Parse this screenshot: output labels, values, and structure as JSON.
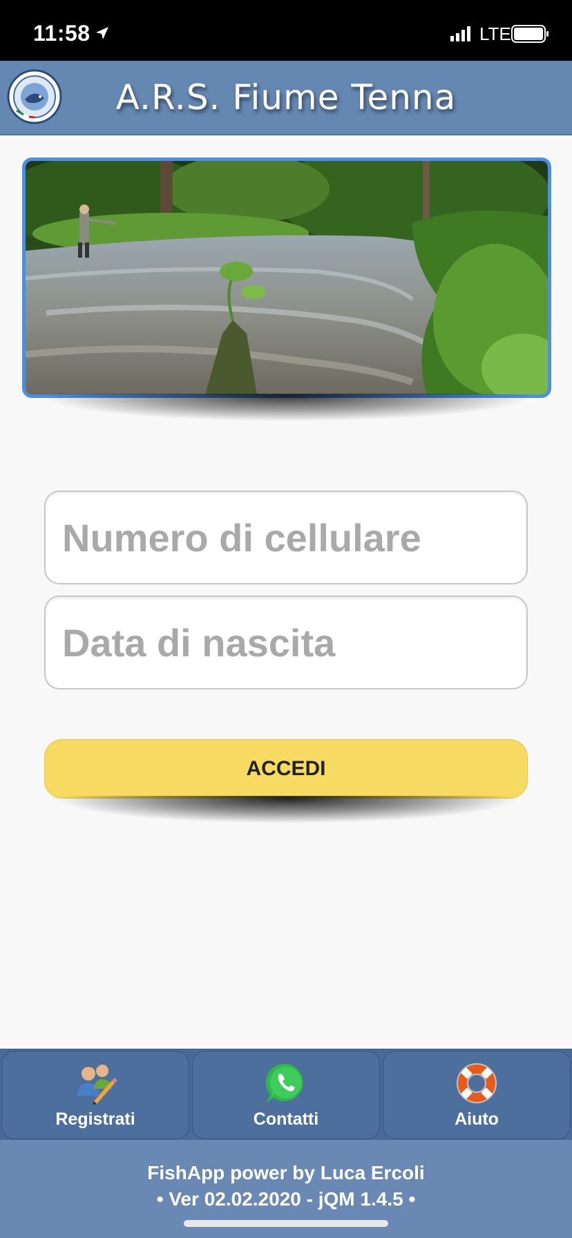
{
  "status_bar": {
    "time": "11:58",
    "network": "LTE",
    "location_icon": "location-arrow-icon",
    "signal_icon": "cellular-signal-icon",
    "battery_icon": "battery-icon"
  },
  "header": {
    "title": "A.R.S. Fiume Tenna",
    "logo_icon": "club-logo-icon",
    "background_color": "#6588b3"
  },
  "banner": {
    "image": "river-fly-fishing-photo",
    "border_color": "#4a8ee8"
  },
  "form": {
    "phone_placeholder": "Numero di cellulare",
    "phone_value": "",
    "dob_placeholder": "Data di nascita",
    "dob_value": "",
    "login_label": "ACCEDI",
    "login_color": "#f6da62"
  },
  "bottom_nav": {
    "items": [
      {
        "label": "Registrati",
        "icon": "users-register-icon"
      },
      {
        "label": "Contatti",
        "icon": "whatsapp-icon"
      },
      {
        "label": "Aiuto",
        "icon": "lifebuoy-icon"
      }
    ]
  },
  "footer": {
    "line1": "FishApp power by Luca Ercoli",
    "line2": "• Ver 02.02.2020 - jQM 1.4.5 •"
  }
}
